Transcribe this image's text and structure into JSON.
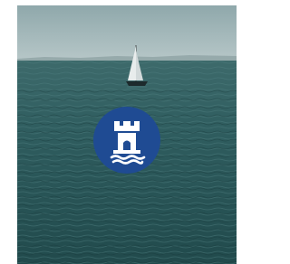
{
  "screen": {
    "background": {
      "description_icon": "sea-with-sailboat-photo",
      "sky_color": "#9fb7b9",
      "horizon_color": "#b8c8c9",
      "water_color": "#2c5b5c",
      "water_dark": "#1f4547"
    },
    "logo": {
      "icon": "castle-tower-on-waves-icon",
      "badge_color": "#1f4b93",
      "glyph_color": "#ffffff"
    }
  }
}
